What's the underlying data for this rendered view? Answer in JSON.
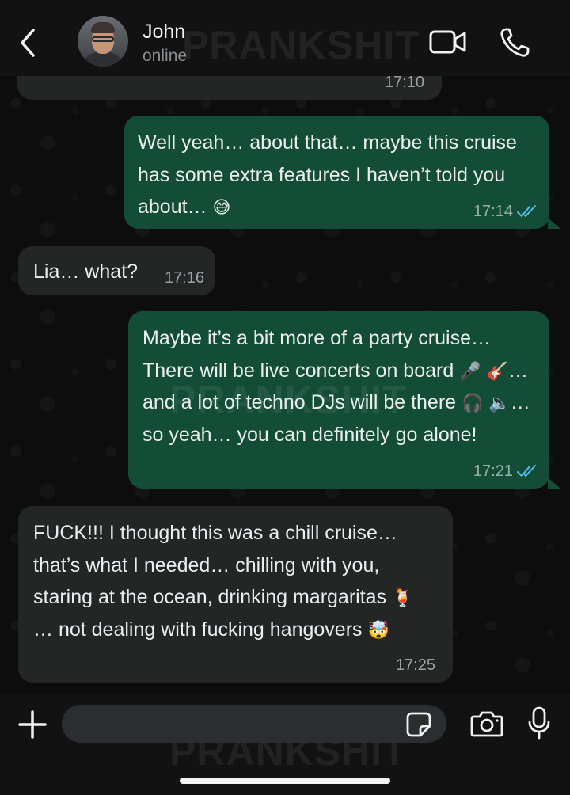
{
  "header": {
    "contact_name": "John",
    "contact_status": "online",
    "watermark": "PRANKSHIT"
  },
  "messages": [
    {
      "direction": "in",
      "text": "",
      "time": "17:10"
    },
    {
      "direction": "out",
      "text": "Well yeah… about that… maybe this cruise has some extra features I haven’t told you about…",
      "emoji_end": "😅",
      "time": "17:14",
      "status": "read"
    },
    {
      "direction": "in",
      "text": "Lia… what?",
      "time": "17:16"
    },
    {
      "direction": "out",
      "parts": [
        "Maybe it’s a bit more of a party cruise… There will be live concerts on board",
        "🎤",
        "🎸",
        "… and a lot of techno DJs will be there",
        "🎧",
        "🔈",
        "… so yeah… you can definitely go alone!"
      ],
      "time": "17:21",
      "status": "read"
    },
    {
      "direction": "in",
      "parts": [
        "FUCK!!! I thought this was a chill cruise… that’s what I needed… chilling with you, staring at the ocean, drinking margaritas",
        "🍹",
        "… not dealing with fucking hangovers",
        "🤯"
      ],
      "time": "17:25"
    }
  ],
  "composer": {
    "input_value": ""
  },
  "colors": {
    "outgoing_bubble": "#134d37",
    "incoming_bubble": "#242626",
    "read_ticks": "#53bdeb"
  }
}
